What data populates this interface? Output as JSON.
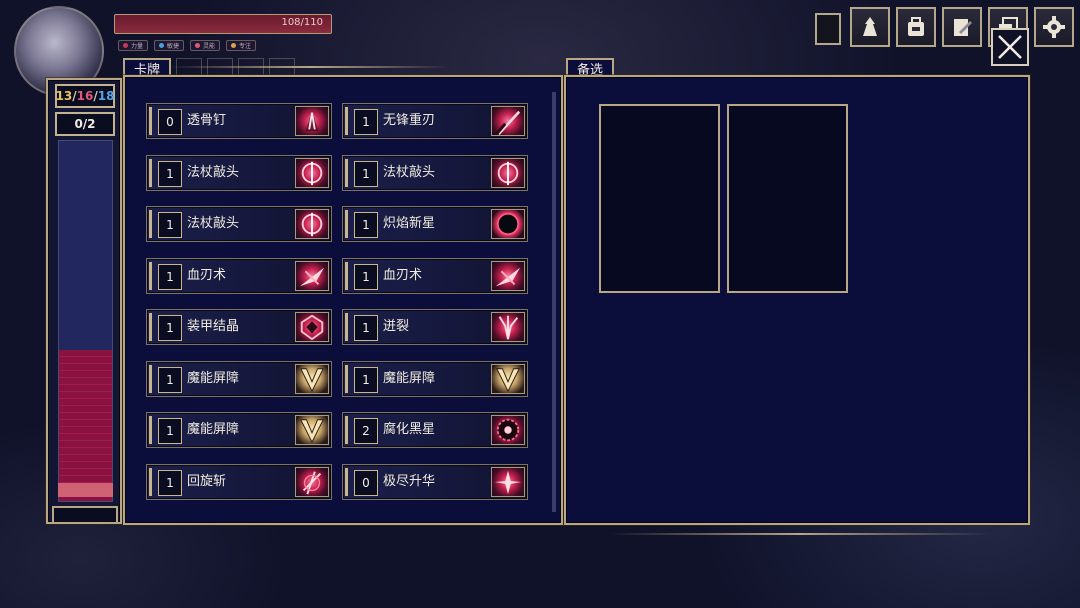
{
  "hud": {
    "hp_text": "108/110",
    "status_chips": [
      {
        "color": "#c43a55",
        "label": "力量"
      },
      {
        "color": "#4aa0d8",
        "label": "敏捷"
      },
      {
        "color": "#e05a78",
        "label": "灵能"
      },
      {
        "color": "#d8a34a",
        "label": "专注"
      }
    ],
    "energy": {
      "a": "13",
      "b": "16",
      "c": "18"
    },
    "discard_count": "0/2",
    "gauge_fraction": 0.42
  },
  "menu": {
    "icons": [
      "character-icon",
      "backpack-icon",
      "card-deck-icon",
      "map-icon",
      "settings-icon"
    ]
  },
  "deck_panel": {
    "tab_label": "卡牌",
    "cards": [
      {
        "cost": "0",
        "name": "透骨钉",
        "art": "nail-art"
      },
      {
        "cost": "1",
        "name": "无锋重刃",
        "art": "blade-art"
      },
      {
        "cost": "1",
        "name": "法杖敲头",
        "art": "staff-art"
      },
      {
        "cost": "1",
        "name": "法杖敲头",
        "art": "staff-art"
      },
      {
        "cost": "1",
        "name": "法杖敲头",
        "art": "staff-art"
      },
      {
        "cost": "1",
        "name": "炽焰新星",
        "art": "nova-art"
      },
      {
        "cost": "1",
        "name": "血刃术",
        "art": "blood-blade-art"
      },
      {
        "cost": "1",
        "name": "血刃术",
        "art": "blood-blade-art"
      },
      {
        "cost": "1",
        "name": "装甲结晶",
        "art": "crystal-art"
      },
      {
        "cost": "1",
        "name": "迸裂",
        "art": "burst-art"
      },
      {
        "cost": "1",
        "name": "魔能屏障",
        "art": "barrier-art"
      },
      {
        "cost": "1",
        "name": "魔能屏障",
        "art": "barrier-art"
      },
      {
        "cost": "1",
        "name": "魔能屏障",
        "art": "barrier-art"
      },
      {
        "cost": "2",
        "name": "腐化黑星",
        "art": "dark-star-art"
      },
      {
        "cost": "1",
        "name": "回旋斩",
        "art": "spin-slash-art"
      },
      {
        "cost": "0",
        "name": "极尽升华",
        "art": "ascend-art"
      }
    ]
  },
  "pick_panel": {
    "tab_label": "备选"
  }
}
